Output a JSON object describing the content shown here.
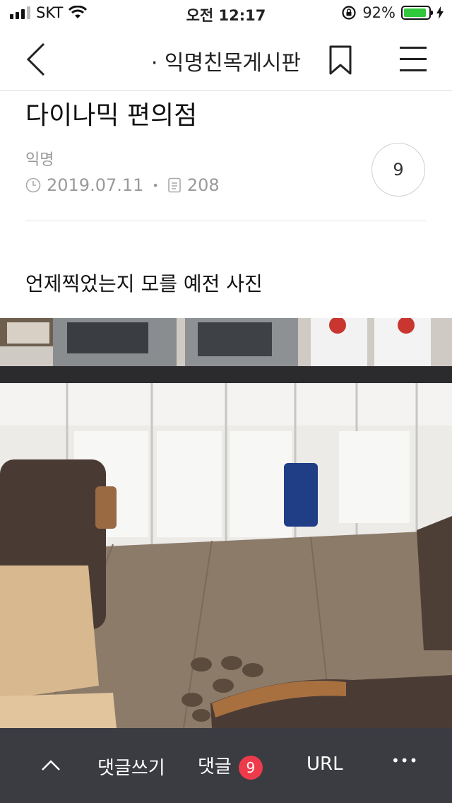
{
  "status_bar": {
    "carrier": "SKT",
    "time": "오전 12:17",
    "battery_percent": "92%",
    "battery_level": 0.92,
    "battery_color": "#31c93c",
    "icons": [
      "signal-icon",
      "wifi-icon",
      "rotation-lock-icon",
      "battery-icon",
      "charging-icon"
    ]
  },
  "nav": {
    "title": "· 익명친목게시판",
    "icons": [
      "back-chevron-icon",
      "bookmark-icon",
      "hamburger-menu-icon"
    ]
  },
  "post": {
    "title": "다이나믹 편의점",
    "author": "익명",
    "date": "2019.07.11",
    "views": "208",
    "comment_count": "9",
    "body": "언제찍었는지 모를 예전 사진"
  },
  "bottom_bar": {
    "write_comment": "댓글쓰기",
    "comments_label": "댓글",
    "comments_badge": "9",
    "url_label": "URL",
    "more_label": "•••",
    "badge_color": "#ee3b4b",
    "icons": [
      "scroll-up-chevron-icon"
    ]
  }
}
